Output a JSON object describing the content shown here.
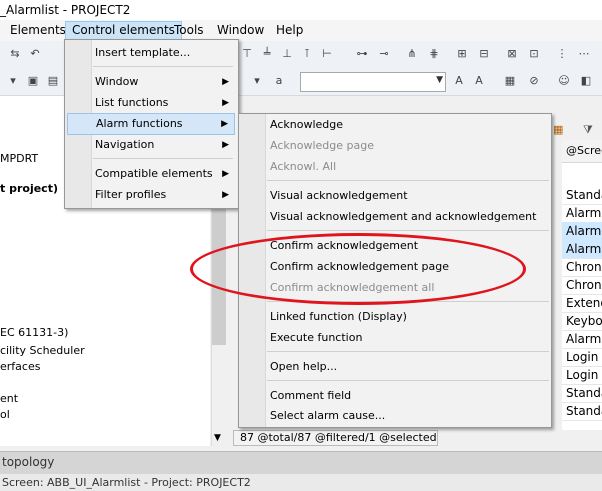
{
  "window": {
    "title": "_Alarmlist - PROJECT2"
  },
  "menubar": [
    "Elements",
    "Control elements",
    "Tools",
    "Window",
    "Help"
  ],
  "control_elements_menu": [
    {
      "label": "Insert template...",
      "submenu": false
    },
    {
      "label": "Window",
      "submenu": true
    },
    {
      "label": "List functions",
      "submenu": true
    },
    {
      "label": "Alarm functions",
      "submenu": true
    },
    {
      "label": "Navigation",
      "submenu": true
    },
    {
      "label": "Compatible elements",
      "submenu": true
    },
    {
      "label": "Filter profiles",
      "submenu": true
    }
  ],
  "alarm_functions_menu": [
    {
      "label": "Acknowledge",
      "disabled": false
    },
    {
      "label": "Acknowledge page",
      "disabled": true
    },
    {
      "label": "Acknowl. All",
      "disabled": true
    },
    {
      "label": "Visual acknowledgement",
      "disabled": false
    },
    {
      "label": "Visual acknowledgement and acknowledgement",
      "disabled": false
    },
    {
      "label": "Confirm acknowledgement",
      "disabled": false
    },
    {
      "label": "Confirm acknowledgement page",
      "disabled": false
    },
    {
      "label": "Confirm acknowledgement all",
      "disabled": true
    },
    {
      "label": "Linked function (Display)",
      "disabled": false
    },
    {
      "label": "Execute function",
      "disabled": false
    },
    {
      "label": "Open help...",
      "disabled": false
    },
    {
      "label": "Comment field",
      "disabled": false
    },
    {
      "label": "Select alarm cause...",
      "disabled": false
    }
  ],
  "left_panel": [
    "MPDRT",
    "t project)",
    "EC 61131-3)",
    "cility Scheduler",
    "erfaces",
    "ent",
    "ol"
  ],
  "right_list": {
    "header": "@Scree",
    "rows": [
      "Standa",
      "Alarm",
      "Alarm",
      "Alarm",
      "Chrono",
      "Chrono",
      "Extend",
      "Keybo",
      "Alarm",
      "Login",
      "Login",
      "Standa",
      "Standa"
    ],
    "selected_indices": [
      2,
      3
    ]
  },
  "status_count": "87 @total/87 @filtered/1 @selected",
  "bottom_panel_label": "topology",
  "status_bar": "Screen: ABB_UI_Alarmlist - Project: PROJECT2",
  "icons": {
    "submenu_arrow": "chevron-right-icon",
    "combo_arrow": "chevron-down-icon"
  },
  "colors": {
    "highlight": "#d4e6f8",
    "annotation_circle": "#e0141c"
  }
}
